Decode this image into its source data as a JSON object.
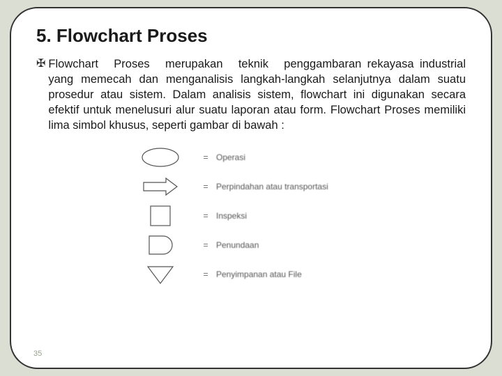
{
  "title": "5. Flowchart Proses",
  "paragraph": {
    "line1": "Flowchart Proses merupakan teknik penggambaran",
    "rest": "rekayasa industrial yang memecah dan menganalisis langkah-langkah selanjutnya dalam suatu prosedur atau sistem. Dalam analisis sistem, flowchart ini digunakan secara efektif untuk menelusuri alur suatu laporan atau form. Flowchart Proses memiliki lima simbol khusus, seperti gambar di bawah :"
  },
  "eq": "=",
  "symbols": [
    {
      "label": "Operasi"
    },
    {
      "label": "Perpindahan atau transportasi"
    },
    {
      "label": "Inspeksi"
    },
    {
      "label": "Penundaan"
    },
    {
      "label": "Penyimpanan atau File"
    }
  ],
  "page": "35"
}
